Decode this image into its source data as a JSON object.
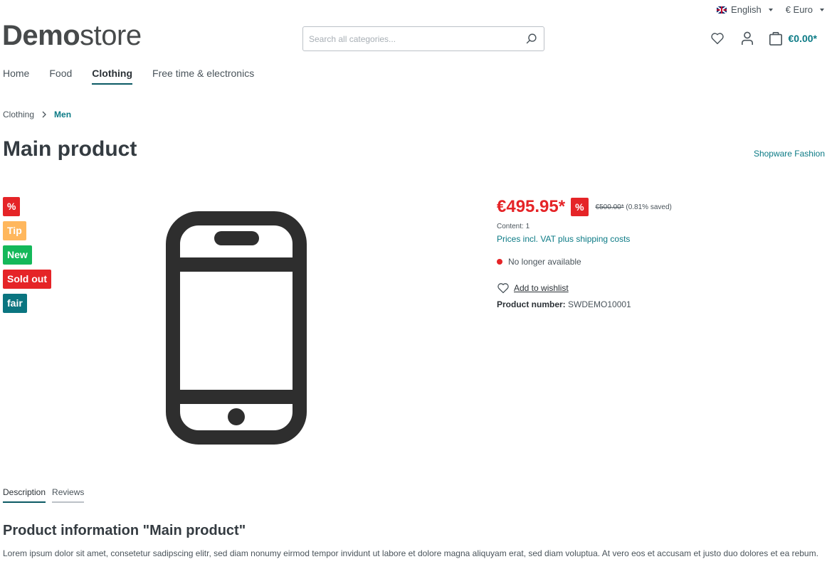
{
  "topbar": {
    "language": "English",
    "currency": "€ Euro"
  },
  "header": {
    "logo_bold": "Demo",
    "logo_light": "store",
    "search_placeholder": "Search all categories...",
    "search_value": "",
    "cart_total": "€0.00*"
  },
  "nav": {
    "items": [
      {
        "label": "Home",
        "active": false
      },
      {
        "label": "Food",
        "active": false
      },
      {
        "label": "Clothing",
        "active": true
      },
      {
        "label": "Free time & electronics",
        "active": false
      }
    ]
  },
  "breadcrumb": {
    "items": [
      "Clothing",
      "Men"
    ]
  },
  "product": {
    "title": "Main product",
    "manufacturer": "Shopware Fashion",
    "badges": [
      {
        "label": "%",
        "color": "#e52427"
      },
      {
        "label": "Tip",
        "color": "#ffb75d"
      },
      {
        "label": "New",
        "color": "#14b85a"
      },
      {
        "label": "Sold out",
        "color": "#e52427"
      },
      {
        "label": "fair",
        "color": "#0b7580"
      }
    ],
    "price": "€495.95*",
    "price_badge": "%",
    "list_price": "€500.00*",
    "savings": "(0.81% saved)",
    "content": "Content: 1",
    "tax_link": "Prices incl. VAT plus shipping costs",
    "delivery_status": "No longer available",
    "wishlist_label": "Add to wishlist",
    "product_number_label": "Product number:",
    "product_number": "SWDEMO10001"
  },
  "tabs": [
    {
      "label": "Description",
      "active": true
    },
    {
      "label": "Reviews",
      "active": false
    }
  ],
  "description": {
    "title": "Product information \"Main product\"",
    "text": "Lorem ipsum dolor sit amet, consetetur sadipscing elitr, sed diam nonumy eirmod tempor invidunt ut labore et dolore magna aliquyam erat, sed diam voluptua. At vero eos et accusam et justo duo dolores et ea rebum."
  },
  "colors": {
    "accent": "#0b7a85",
    "price_red": "#e52427"
  }
}
